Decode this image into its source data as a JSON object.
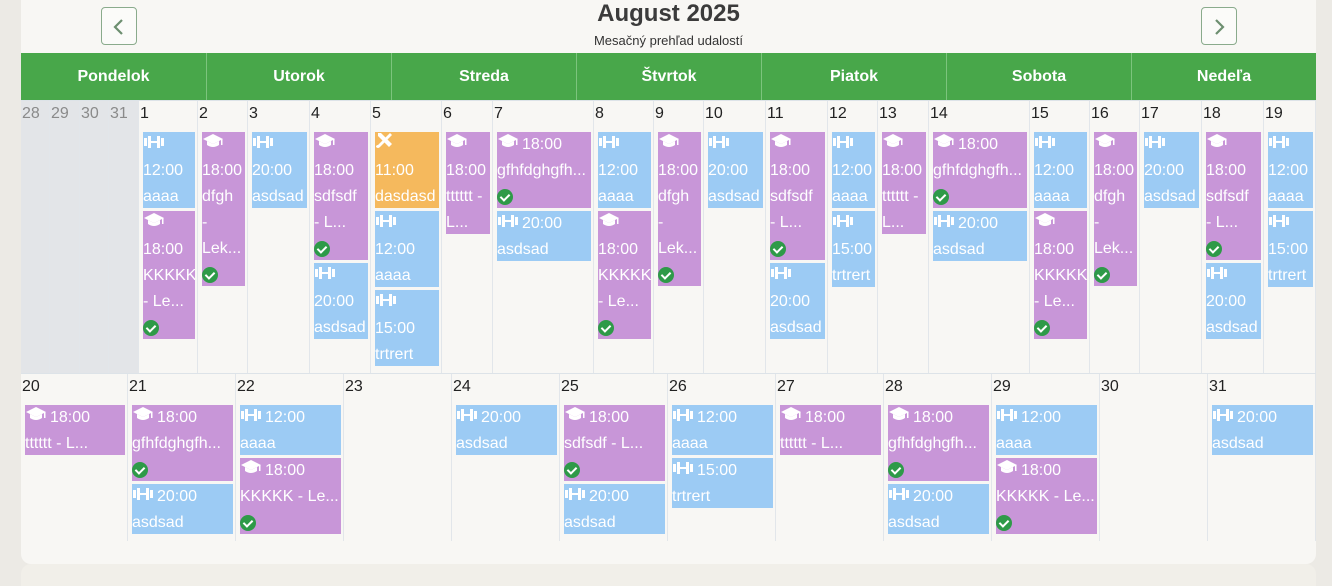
{
  "calendar": {
    "title": "August 2025",
    "subtitle": "Mesačný prehľad udalostí",
    "prev_icon": "chevron-left-icon",
    "next_icon": "chevron-right-icon",
    "weekdays": [
      "Pondelok",
      "Utorok",
      "Streda",
      "Štvrtok",
      "Piatok",
      "Sobota",
      "Nedeľa"
    ],
    "colors": {
      "header": "#48a74a",
      "training": "#9ccbf4",
      "lesson": "#c896d8",
      "repair": "#f5b95d",
      "check": "#2e9a48"
    }
  },
  "weeks": [
    {
      "days": [
        {
          "num": "28",
          "other": true,
          "events": []
        },
        {
          "num": "29",
          "other": true,
          "events": []
        },
        {
          "num": "30",
          "other": true,
          "events": []
        },
        {
          "num": "31",
          "other": true,
          "events": []
        },
        {
          "num": "1",
          "events": [
            {
              "type": "training",
              "icon": "dumbbell-icon",
              "lines": [
                "",
                "12:00",
                "aaaa"
              ]
            },
            {
              "type": "lesson",
              "icon": "graduation-cap-icon",
              "lines": [
                "",
                "18:00",
                "KKKKK",
                "- Le..."
              ],
              "check": true
            }
          ]
        },
        {
          "num": "2",
          "events": [
            {
              "type": "lesson",
              "icon": "graduation-cap-icon",
              "lines": [
                "",
                "18:00",
                "dfgh",
                "-",
                "Lek..."
              ],
              "check": true
            }
          ]
        },
        {
          "num": "3",
          "events": [
            {
              "type": "training",
              "icon": "dumbbell-icon",
              "lines": [
                "",
                "20:00",
                "asdsad"
              ]
            }
          ]
        },
        {
          "num": "4",
          "events": [
            {
              "type": "lesson",
              "icon": "graduation-cap-icon",
              "lines": [
                "",
                "18:00",
                "sdfsdf",
                "- L..."
              ],
              "check": true
            },
            {
              "type": "training",
              "icon": "dumbbell-icon",
              "lines": [
                "",
                "20:00",
                "asdsad"
              ]
            }
          ]
        },
        {
          "num": "5",
          "events": [
            {
              "type": "repair",
              "icon": "tools-icon",
              "lines": [
                "",
                "11:00",
                "dasdasd"
              ]
            },
            {
              "type": "training",
              "icon": "dumbbell-icon",
              "lines": [
                "",
                "12:00",
                "aaaa"
              ]
            },
            {
              "type": "training",
              "icon": "dumbbell-icon",
              "lines": [
                "",
                "15:00",
                "trtrert"
              ]
            }
          ]
        },
        {
          "num": "6",
          "events": [
            {
              "type": "lesson",
              "icon": "graduation-cap-icon",
              "lines": [
                "",
                "18:00",
                "tttttt -",
                "L..."
              ]
            }
          ]
        },
        {
          "num": "7",
          "events": [
            {
              "type": "lesson",
              "icon": "graduation-cap-icon",
              "lines": [
                "18:00",
                "gfhfdghgfh..."
              ],
              "check": true
            },
            {
              "type": "training",
              "icon": "dumbbell-icon",
              "lines": [
                "20:00",
                "asdsad"
              ]
            }
          ]
        },
        {
          "num": "8",
          "events": [
            {
              "type": "training",
              "icon": "dumbbell-icon",
              "lines": [
                "",
                "12:00",
                "aaaa"
              ]
            },
            {
              "type": "lesson",
              "icon": "graduation-cap-icon",
              "lines": [
                "",
                "18:00",
                "KKKKK",
                "- Le..."
              ],
              "check": true
            }
          ]
        },
        {
          "num": "9",
          "events": [
            {
              "type": "lesson",
              "icon": "graduation-cap-icon",
              "lines": [
                "",
                "18:00",
                "dfgh",
                "-",
                "Lek..."
              ],
              "check": true
            }
          ]
        },
        {
          "num": "10",
          "events": [
            {
              "type": "training",
              "icon": "dumbbell-icon",
              "lines": [
                "",
                "20:00",
                "asdsad"
              ]
            }
          ]
        },
        {
          "num": "11",
          "events": [
            {
              "type": "lesson",
              "icon": "graduation-cap-icon",
              "lines": [
                "",
                "18:00",
                "sdfsdf",
                "- L..."
              ],
              "check": true
            },
            {
              "type": "training",
              "icon": "dumbbell-icon",
              "lines": [
                "",
                "20:00",
                "asdsad"
              ]
            }
          ]
        },
        {
          "num": "12",
          "events": [
            {
              "type": "training",
              "icon": "dumbbell-icon",
              "lines": [
                "",
                "12:00",
                "aaaa"
              ]
            },
            {
              "type": "training",
              "icon": "dumbbell-icon",
              "lines": [
                "",
                "15:00",
                "trtrert"
              ]
            }
          ]
        },
        {
          "num": "13",
          "events": [
            {
              "type": "lesson",
              "icon": "graduation-cap-icon",
              "lines": [
                "",
                "18:00",
                "tttttt -",
                "L..."
              ]
            }
          ]
        },
        {
          "num": "14",
          "events": [
            {
              "type": "lesson",
              "icon": "graduation-cap-icon",
              "lines": [
                "18:00",
                "gfhfdghgfh..."
              ],
              "check": true
            },
            {
              "type": "training",
              "icon": "dumbbell-icon",
              "lines": [
                "20:00",
                "asdsad"
              ]
            }
          ]
        },
        {
          "num": "15",
          "events": [
            {
              "type": "training",
              "icon": "dumbbell-icon",
              "lines": [
                "",
                "12:00",
                "aaaa"
              ]
            },
            {
              "type": "lesson",
              "icon": "graduation-cap-icon",
              "lines": [
                "",
                "18:00",
                "KKKKK",
                "- Le..."
              ],
              "check": true
            }
          ]
        },
        {
          "num": "16",
          "events": [
            {
              "type": "lesson",
              "icon": "graduation-cap-icon",
              "lines": [
                "",
                "18:00",
                "dfgh",
                "-",
                "Lek..."
              ],
              "check": true
            }
          ]
        },
        {
          "num": "17",
          "events": [
            {
              "type": "training",
              "icon": "dumbbell-icon",
              "lines": [
                "",
                "20:00",
                "asdsad"
              ]
            }
          ]
        },
        {
          "num": "18",
          "events": [
            {
              "type": "lesson",
              "icon": "graduation-cap-icon",
              "lines": [
                "",
                "18:00",
                "sdfsdf",
                "- L..."
              ],
              "check": true
            },
            {
              "type": "training",
              "icon": "dumbbell-icon",
              "lines": [
                "",
                "20:00",
                "asdsad"
              ]
            }
          ]
        },
        {
          "num": "19",
          "events": [
            {
              "type": "training",
              "icon": "dumbbell-icon",
              "lines": [
                "",
                "12:00",
                "aaaa"
              ]
            },
            {
              "type": "training",
              "icon": "dumbbell-icon",
              "lines": [
                "",
                "15:00",
                "trtrert"
              ]
            }
          ]
        }
      ]
    },
    {
      "days": [
        {
          "num": "20",
          "events": [
            {
              "type": "lesson",
              "icon": "graduation-cap-icon",
              "lines": [
                "18:00",
                "tttttt - L..."
              ]
            }
          ]
        },
        {
          "num": "21",
          "events": [
            {
              "type": "lesson",
              "icon": "graduation-cap-icon",
              "lines": [
                "18:00",
                "gfhfdghgfh..."
              ],
              "check": true
            },
            {
              "type": "training",
              "icon": "dumbbell-icon",
              "lines": [
                "20:00",
                "asdsad"
              ]
            }
          ]
        },
        {
          "num": "22",
          "events": [
            {
              "type": "training",
              "icon": "dumbbell-icon",
              "lines": [
                "12:00",
                "aaaa"
              ]
            },
            {
              "type": "lesson",
              "icon": "graduation-cap-icon",
              "lines": [
                "18:00",
                "KKKKK - Le..."
              ],
              "check": true
            }
          ]
        },
        {
          "num": "23",
          "events": []
        },
        {
          "num": "24",
          "events": [
            {
              "type": "training",
              "icon": "dumbbell-icon",
              "lines": [
                "20:00",
                "asdsad"
              ]
            }
          ]
        },
        {
          "num": "25",
          "events": [
            {
              "type": "lesson",
              "icon": "graduation-cap-icon",
              "lines": [
                "18:00",
                "sdfsdf - L..."
              ],
              "check": true
            },
            {
              "type": "training",
              "icon": "dumbbell-icon",
              "lines": [
                "20:00",
                "asdsad"
              ]
            }
          ]
        },
        {
          "num": "26",
          "events": [
            {
              "type": "training",
              "icon": "dumbbell-icon",
              "lines": [
                "12:00",
                "aaaa"
              ]
            },
            {
              "type": "training",
              "icon": "dumbbell-icon",
              "lines": [
                "15:00",
                "trtrert"
              ]
            }
          ]
        },
        {
          "num": "27",
          "events": [
            {
              "type": "lesson",
              "icon": "graduation-cap-icon",
              "lines": [
                "18:00",
                "tttttt - L..."
              ]
            }
          ]
        },
        {
          "num": "28",
          "events": [
            {
              "type": "lesson",
              "icon": "graduation-cap-icon",
              "lines": [
                "18:00",
                "gfhfdghgfh..."
              ],
              "check": true
            },
            {
              "type": "training",
              "icon": "dumbbell-icon",
              "lines": [
                "20:00",
                "asdsad"
              ]
            }
          ]
        },
        {
          "num": "29",
          "events": [
            {
              "type": "training",
              "icon": "dumbbell-icon",
              "lines": [
                "12:00",
                "aaaa"
              ]
            },
            {
              "type": "lesson",
              "icon": "graduation-cap-icon",
              "lines": [
                "18:00",
                "KKKKK - Le..."
              ],
              "check": true
            }
          ]
        },
        {
          "num": "30",
          "events": []
        },
        {
          "num": "31",
          "events": [
            {
              "type": "training",
              "icon": "dumbbell-icon",
              "lines": [
                "20:00",
                "asdsad"
              ]
            }
          ]
        }
      ]
    }
  ]
}
